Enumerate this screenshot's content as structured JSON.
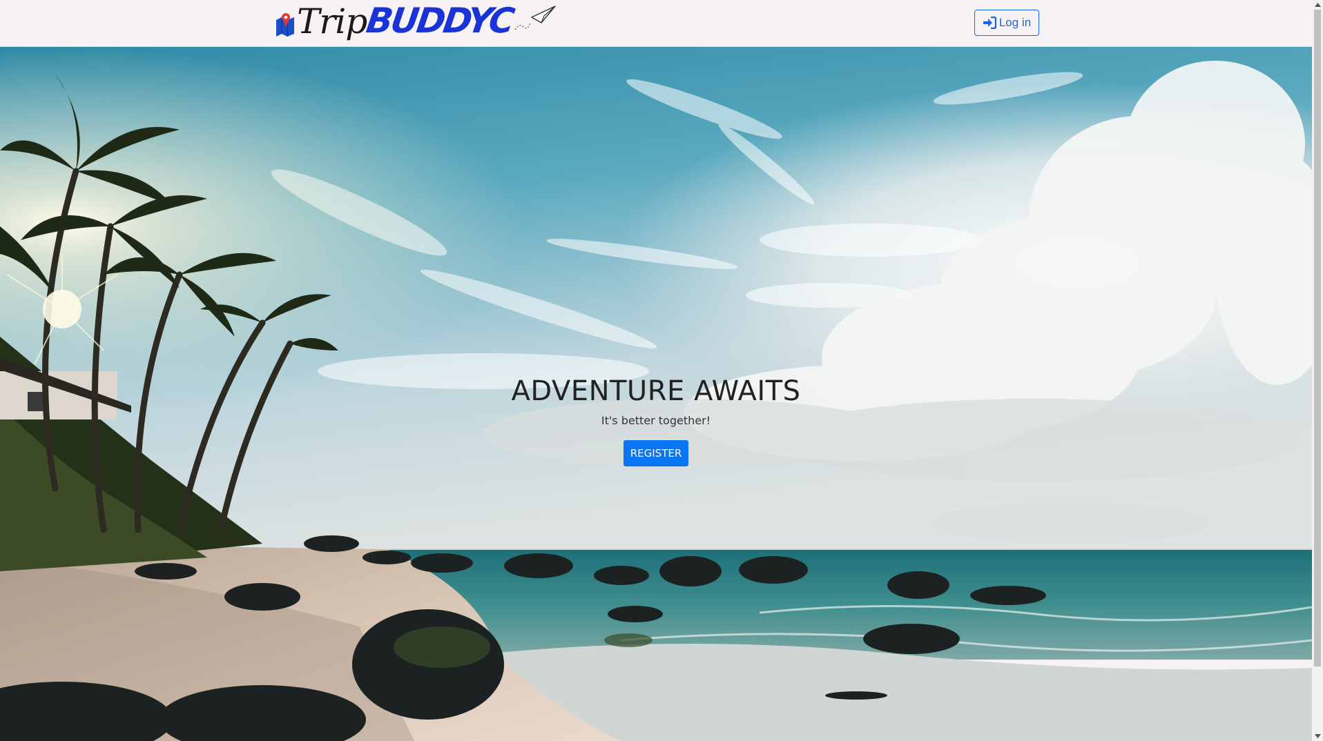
{
  "brand": {
    "name_part1": "Trip",
    "name_part2": "BUDDYC",
    "logo_icon": "map-pin-icon",
    "plane_icon": "paper-plane-icon",
    "accent_color": "#1a33d6"
  },
  "navbar": {
    "login_label": "Log in",
    "login_icon": "sign-in-icon",
    "login_color": "#1366e9"
  },
  "hero": {
    "title": "ADVENTURE AWAITS",
    "subtitle": "It's better together!",
    "register_label": "REGISTER",
    "register_color": "#0a75f0",
    "background": "beach-with-palm-trees-and-rocks"
  }
}
